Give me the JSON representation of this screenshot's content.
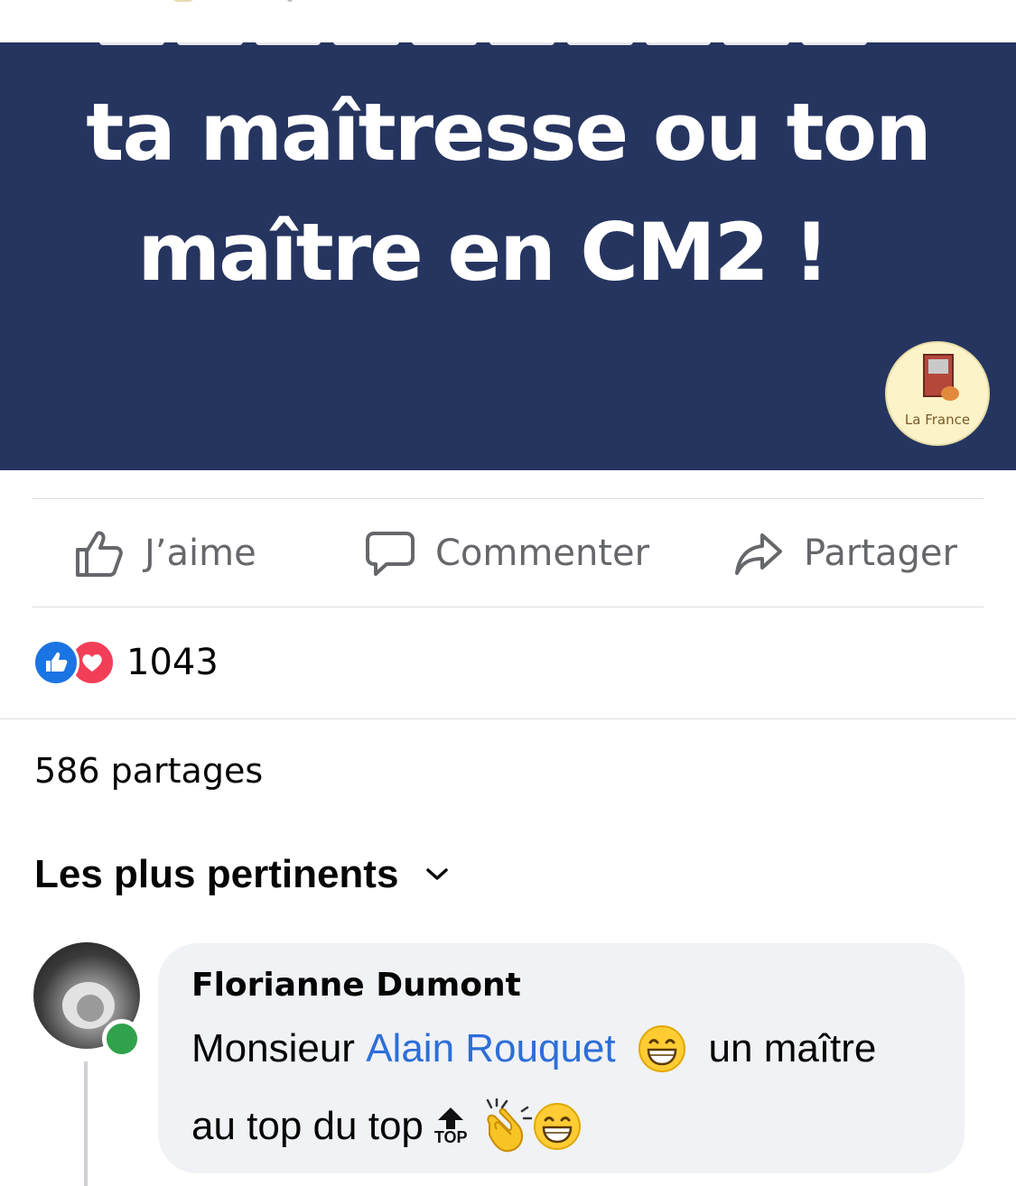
{
  "banner": {
    "line1": "ta maîtresse ou ton",
    "line2": "maître en CM2 !",
    "logo_text": "La France",
    "background_color": "#263560"
  },
  "actions": {
    "like_label": "J’aime",
    "comment_label": "Commenter",
    "share_label": "Partager"
  },
  "reactions": {
    "icons": [
      "like-icon",
      "love-icon"
    ],
    "count": "1043"
  },
  "shares": "586 partages",
  "sort": {
    "label": "Les plus pertinents"
  },
  "comment": {
    "author": "Florianne Dumont",
    "text_before_mention": "Monsieur",
    "mention": "Alain Rouquet",
    "text_after_mention": "un maître",
    "line2": "au top du top",
    "top_emoji_label": "TOP",
    "emojis": [
      "grinning-face-icon",
      "top-arrow-icon",
      "clapping-hands-icon",
      "grinning-face-icon"
    ]
  },
  "colors": {
    "accent_link": "#2d6ed8",
    "like_blue": "#1b74e4",
    "love_red": "#f33e58",
    "online_green": "#31a24c"
  }
}
